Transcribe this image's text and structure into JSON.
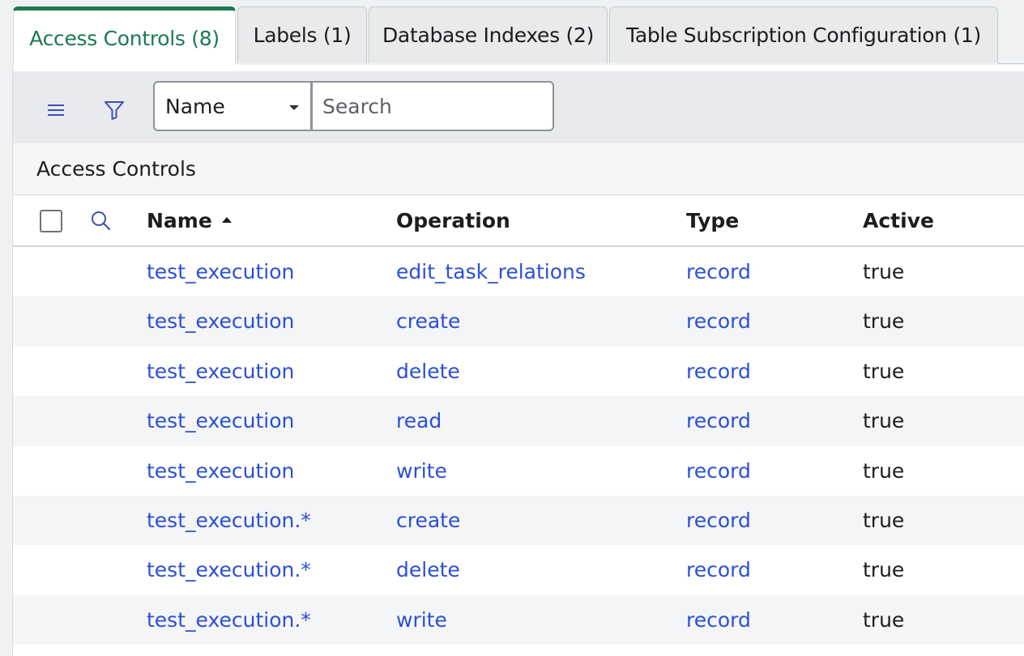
{
  "tabs": [
    {
      "label": "Access Controls (8)",
      "active": true
    },
    {
      "label": "Labels (1)",
      "active": false
    },
    {
      "label": "Database Indexes (2)",
      "active": false
    },
    {
      "label": "Table Subscription Configuration (1)",
      "active": false
    }
  ],
  "toolbar": {
    "menu_icon": "hamburger-menu-icon",
    "filter_icon": "funnel-filter-icon",
    "field_select": {
      "value": "Name"
    },
    "search": {
      "value": "",
      "placeholder": "Search"
    }
  },
  "list": {
    "title": "Access Controls",
    "columns": [
      {
        "label": "Name",
        "sorted": "ascending"
      },
      {
        "label": "Operation"
      },
      {
        "label": "Type"
      },
      {
        "label": "Active"
      }
    ],
    "rows": [
      {
        "name": "test_execution",
        "operation": "edit_task_relations",
        "type": "record",
        "active": "true"
      },
      {
        "name": "test_execution",
        "operation": "create",
        "type": "record",
        "active": "true"
      },
      {
        "name": "test_execution",
        "operation": "delete",
        "type": "record",
        "active": "true"
      },
      {
        "name": "test_execution",
        "operation": "read",
        "type": "record",
        "active": "true"
      },
      {
        "name": "test_execution",
        "operation": "write",
        "type": "record",
        "active": "true"
      },
      {
        "name": "test_execution.*",
        "operation": "create",
        "type": "record",
        "active": "true"
      },
      {
        "name": "test_execution.*",
        "operation": "delete",
        "type": "record",
        "active": "true"
      },
      {
        "name": "test_execution.*",
        "operation": "write",
        "type": "record",
        "active": "true"
      }
    ]
  },
  "colors": {
    "accent": "#1b7a52",
    "link": "#2c4fd6",
    "icon": "#3d4fb8"
  }
}
